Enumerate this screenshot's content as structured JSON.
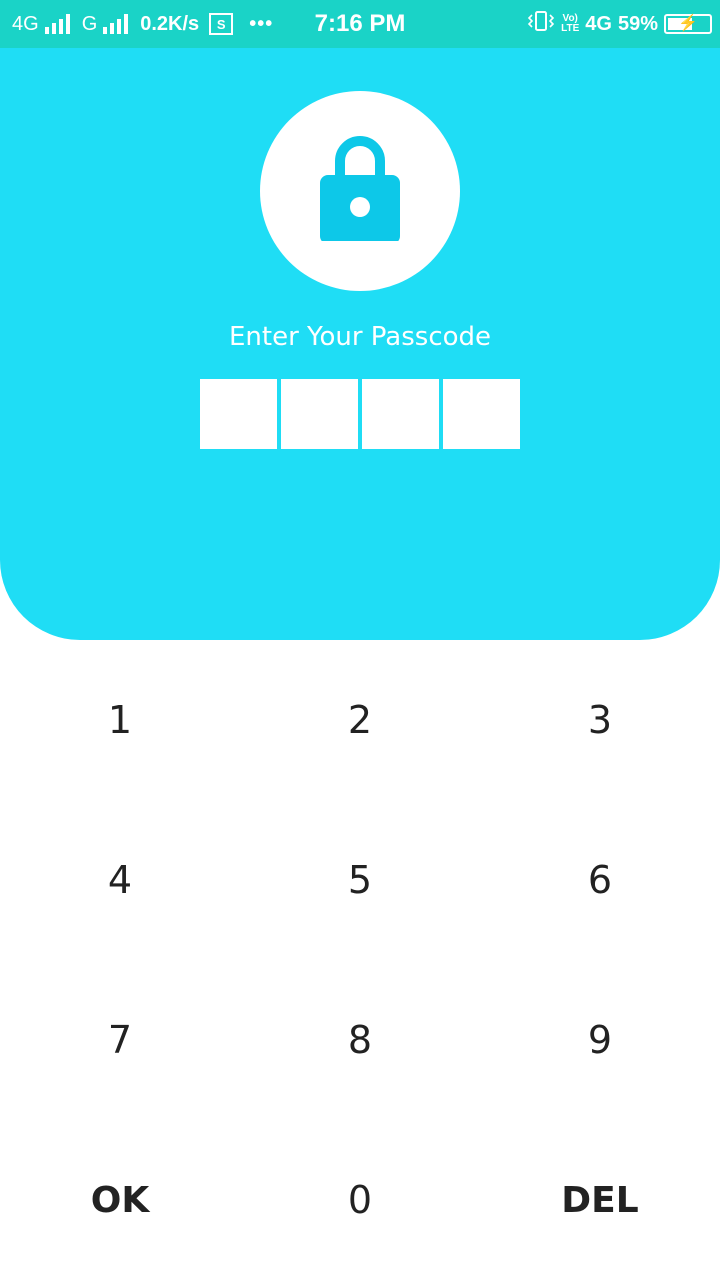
{
  "status_bar": {
    "net1": "4G",
    "net2": "G",
    "speed": "0.2K/s",
    "s_icon": "S",
    "dots": "•••",
    "time": "7:16 PM",
    "volte_top": "Vo)",
    "volte_bottom": "LTE",
    "net3": "4G",
    "battery_percent": "59%",
    "battery_level": 0.59,
    "bg_color": "#1ad3c7"
  },
  "header": {
    "bg_color": "#1fddf5",
    "lock_icon": "lock-icon",
    "prompt": "Enter Your Passcode",
    "passcode_length": 4
  },
  "keypad": {
    "keys": [
      "1",
      "2",
      "3",
      "4",
      "5",
      "6",
      "7",
      "8",
      "9",
      "OK",
      "0",
      "DEL"
    ]
  }
}
